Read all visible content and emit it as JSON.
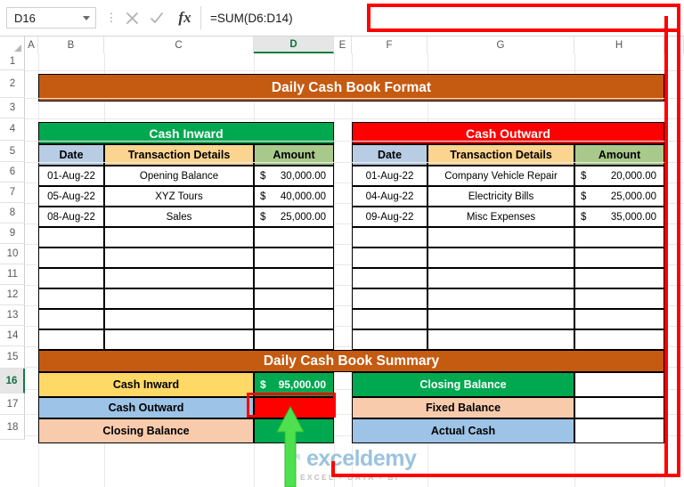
{
  "formula_bar": {
    "name_box_value": "D16",
    "cancel_icon": "close-icon",
    "confirm_icon": "check-icon",
    "fx_label": "fx",
    "formula": "=SUM(D6:D14)"
  },
  "grid": {
    "columns": [
      "A",
      "B",
      "C",
      "D",
      "E",
      "F",
      "G",
      "H"
    ],
    "selected_column": "D",
    "rows": [
      "1",
      "2",
      "3",
      "4",
      "5",
      "6",
      "7",
      "8",
      "9",
      "10",
      "11",
      "12",
      "13",
      "14",
      "15",
      "16",
      "17",
      "18"
    ],
    "selected_row": "16"
  },
  "report": {
    "title": "Daily Cash Book Format",
    "inward_header": "Cash Inward",
    "outward_header": "Cash Outward",
    "sub_headers": {
      "date": "Date",
      "details": "Transaction Details",
      "amount": "Amount"
    },
    "currency_symbol": "$",
    "inward_rows": [
      {
        "date": "01-Aug-22",
        "details": "Opening Balance",
        "amount": "30,000.00"
      },
      {
        "date": "05-Aug-22",
        "details": "XYZ Tours",
        "amount": "40,000.00"
      },
      {
        "date": "08-Aug-22",
        "details": "Sales",
        "amount": "25,000.00"
      }
    ],
    "outward_rows": [
      {
        "date": "01-Aug-22",
        "details": "Company Vehicle Repair",
        "amount": "20,000.00"
      },
      {
        "date": "04-Aug-22",
        "details": "Electricity Bills",
        "amount": "25,000.00"
      },
      {
        "date": "09-Aug-22",
        "details": "Misc Expenses",
        "amount": "35,000.00"
      }
    ],
    "empty_row_count": 6
  },
  "summary": {
    "title": "Daily Cash Book Summary",
    "left": [
      {
        "label": "Cash Inward",
        "value_currency": "$",
        "value": "95,000.00",
        "selected": true
      },
      {
        "label": "Cash Outward",
        "value_currency": "",
        "value": "",
        "selected": false
      },
      {
        "label": "Closing Balance",
        "value_currency": "",
        "value": "",
        "selected": false
      }
    ],
    "right": [
      {
        "label": "Closing Balance",
        "value": ""
      },
      {
        "label": "Fixed Balance",
        "value": ""
      },
      {
        "label": "Actual Cash",
        "value": ""
      }
    ]
  },
  "watermark": {
    "text": "exceldemy",
    "tagline": "EXCEL - DATA - BI"
  },
  "annotations": {
    "arrow": "up-arrow-annotation",
    "selection_outline": "red-selection-outline",
    "highlight_rect": "red-highlight-rectangle"
  },
  "colors": {
    "title_band": "#C55A11",
    "inward": "#00A84F",
    "outward": "#FF0000",
    "date_header": "#B8CCE4",
    "details_header": "#FBD490",
    "amount_header": "#A9C98C",
    "label_yellow": "#FFD966",
    "label_blue": "#9DC3E6",
    "label_peach": "#F8CBAD",
    "annotation_red": "#FF0000",
    "arrow_green": "#4EE04E",
    "excel_green": "#107C41"
  }
}
